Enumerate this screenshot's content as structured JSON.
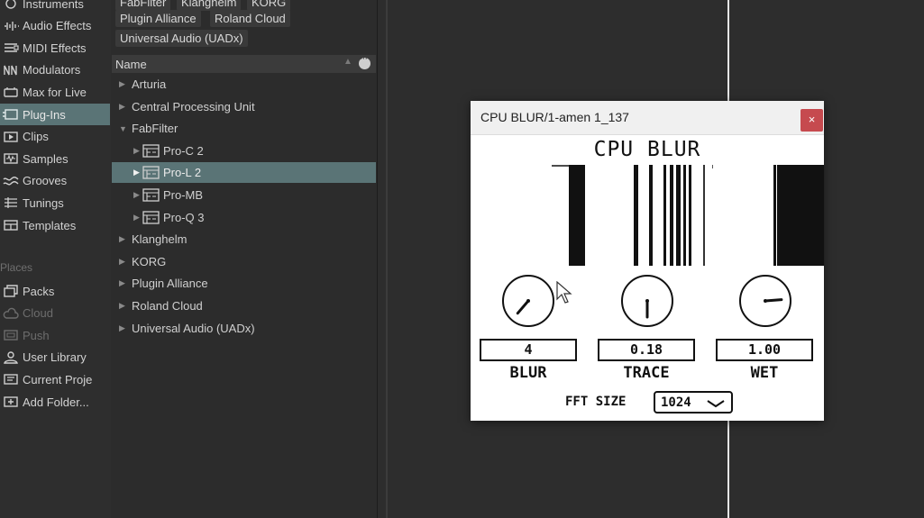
{
  "sidebar": {
    "categories": [
      {
        "label": "Instruments",
        "icon": "instruments-icon"
      },
      {
        "label": "Audio Effects",
        "icon": "audio-effects-icon"
      },
      {
        "label": "MIDI Effects",
        "icon": "midi-effects-icon"
      },
      {
        "label": "Modulators",
        "icon": "modulators-icon"
      },
      {
        "label": "Max for Live",
        "icon": "max-for-live-icon"
      },
      {
        "label": "Plug-Ins",
        "icon": "plug-ins-icon",
        "selected": true
      },
      {
        "label": "Clips",
        "icon": "clips-icon"
      },
      {
        "label": "Samples",
        "icon": "samples-icon"
      },
      {
        "label": "Grooves",
        "icon": "grooves-icon"
      },
      {
        "label": "Tunings",
        "icon": "tunings-icon"
      },
      {
        "label": "Templates",
        "icon": "templates-icon"
      }
    ],
    "places_title": "Places",
    "places": [
      {
        "label": "Packs",
        "icon": "packs-icon"
      },
      {
        "label": "Cloud",
        "icon": "cloud-icon",
        "disabled": true
      },
      {
        "label": "Push",
        "icon": "push-icon",
        "disabled": true
      },
      {
        "label": "User Library",
        "icon": "user-icon"
      },
      {
        "label": "Current Proje",
        "icon": "current-project-icon"
      },
      {
        "label": "Add Folder...",
        "icon": "add-folder-icon"
      }
    ]
  },
  "browser": {
    "tags": [
      "FabFilter",
      "Klanghelm",
      "KORG",
      "Plugin Alliance",
      "Roland Cloud",
      "Universal Audio (UADx)"
    ],
    "column_header": "Name",
    "items": [
      {
        "label": "Arturia",
        "level": 0,
        "arrow": "▶"
      },
      {
        "label": "Central Processing Unit",
        "level": 0,
        "arrow": "▶"
      },
      {
        "label": "FabFilter",
        "level": 0,
        "arrow": "▼"
      },
      {
        "label": "Pro-C 2",
        "level": 1,
        "arrow": "▶",
        "plugin": true
      },
      {
        "label": "Pro-L 2",
        "level": 1,
        "arrow": "▶",
        "plugin": true,
        "selected": true
      },
      {
        "label": "Pro-MB",
        "level": 1,
        "arrow": "▶",
        "plugin": true
      },
      {
        "label": "Pro-Q 3",
        "level": 1,
        "arrow": "▶",
        "plugin": true
      },
      {
        "label": "Klanghelm",
        "level": 0,
        "arrow": "▶"
      },
      {
        "label": "KORG",
        "level": 0,
        "arrow": "▶"
      },
      {
        "label": "Plugin Alliance",
        "level": 0,
        "arrow": "▶"
      },
      {
        "label": "Roland Cloud",
        "level": 0,
        "arrow": "▶"
      },
      {
        "label": "Universal Audio (UADx)",
        "level": 0,
        "arrow": "▶"
      }
    ]
  },
  "plugin_window": {
    "title": "CPU BLUR/1-amen 1_137",
    "close_label": "×",
    "plugin_name": "CPU BLUR",
    "params": [
      {
        "label": "BLUR",
        "value": "4",
        "knob_level": 0.35
      },
      {
        "label": "TRACE",
        "value": "0.18",
        "knob_level": 0.5
      },
      {
        "label": "WET",
        "value": "1.00",
        "knob_level": 0.85
      }
    ],
    "fft_label": "FFT SIZE",
    "fft_value": "1024"
  },
  "colors": {
    "selection": "#5a7476",
    "close_button": "#c64a4f",
    "panel_bg": "#2c2c2c",
    "plugin_bg": "#ffffff"
  }
}
